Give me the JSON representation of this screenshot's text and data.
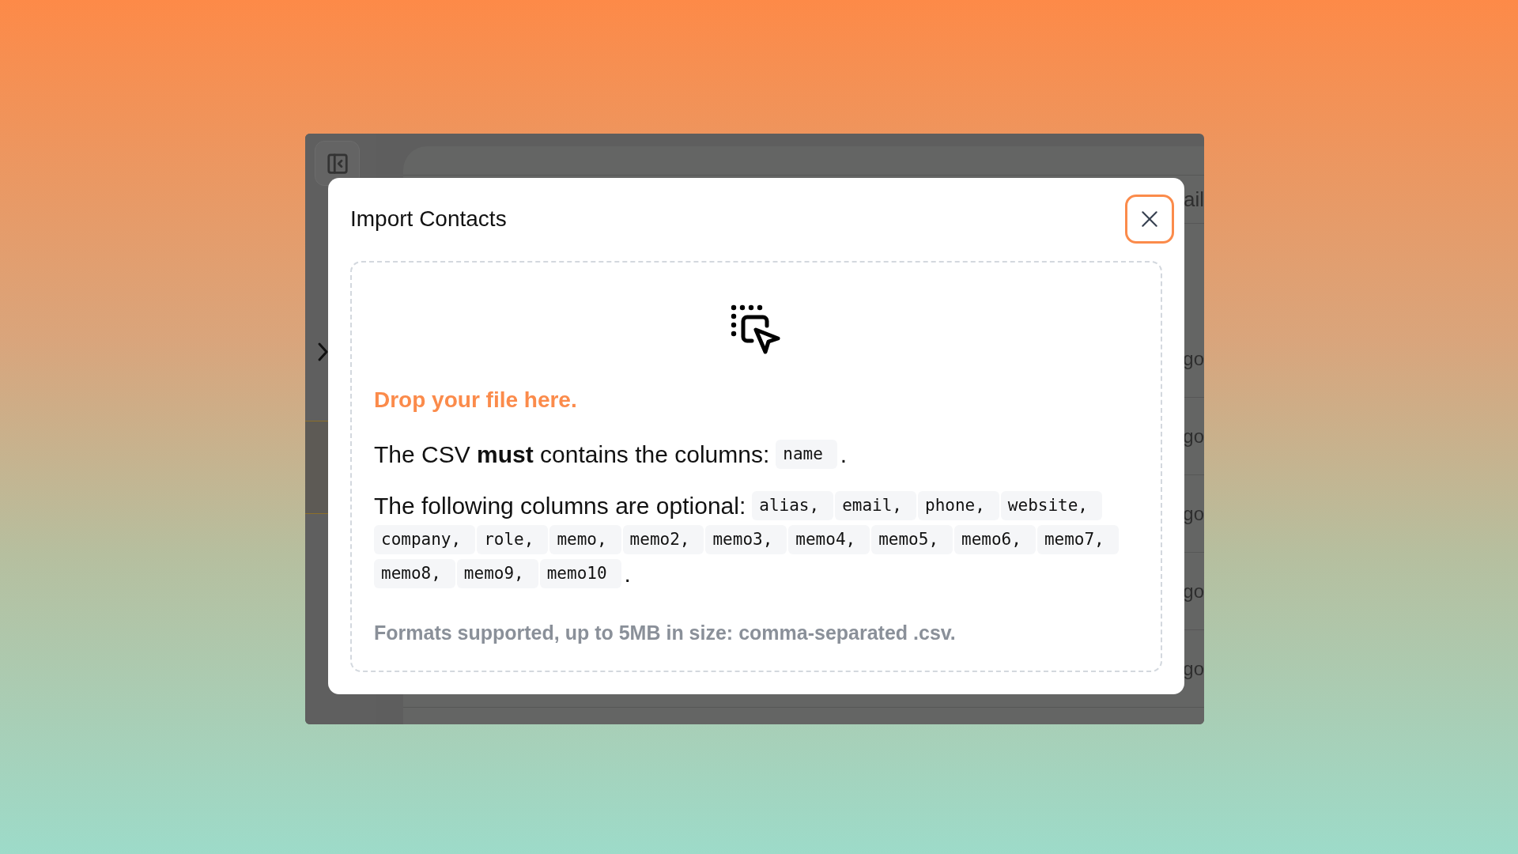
{
  "background_app": {
    "table": {
      "header": "ail",
      "rows": [
        "go",
        "go",
        "go",
        "go",
        "go"
      ]
    }
  },
  "modal": {
    "title": "Import Contacts",
    "drop_text": "Drop your file here.",
    "required": {
      "text": "The CSV **must** contains the columns:",
      "columns": [
        "name"
      ],
      "end": "."
    },
    "optional": {
      "text": "The following columns are optional:",
      "columns": [
        "alias,",
        "email,",
        "phone,",
        "website,",
        "company,",
        "role,",
        "memo,",
        "memo2,",
        "memo3,",
        "memo4,",
        "memo5,",
        "memo6,",
        "memo7,",
        "memo8,",
        "memo9,",
        "memo10"
      ],
      "end": "."
    },
    "formats": "Formats supported, up to 5MB in size: comma-separated .csv."
  }
}
